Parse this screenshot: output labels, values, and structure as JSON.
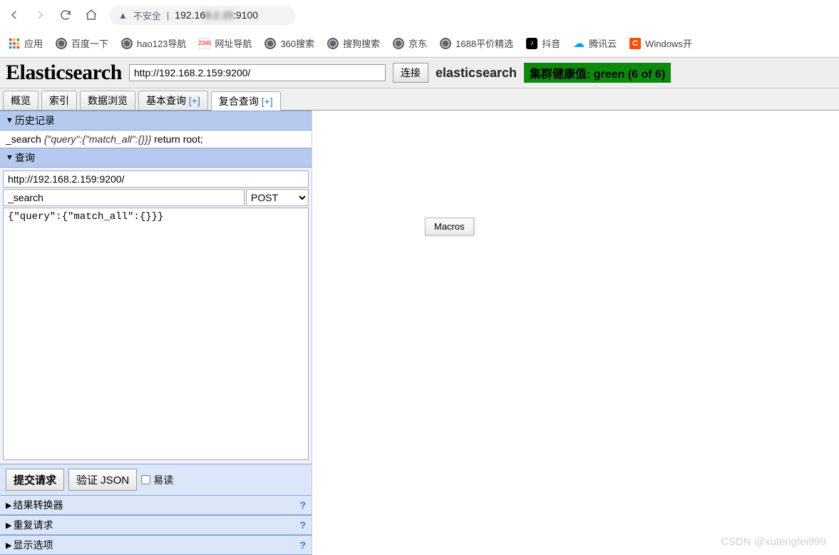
{
  "browser": {
    "insecure_label": "不安全",
    "url_display_prefix": "192.16",
    "url_display_mid": "8.2.15",
    "url_display_suffix": ":9100"
  },
  "bookmarks": {
    "apps": "应用",
    "items": [
      "百度一下",
      "hao123导航",
      "网址导航",
      "360搜索",
      "搜狗搜索",
      "京东",
      "1688平价精选",
      "抖音",
      "腾讯云",
      "Windows开"
    ]
  },
  "es": {
    "logo": "Elasticsearch",
    "server_url": "http://192.168.2.159:9200/",
    "connect_btn": "连接",
    "cluster_name": "elasticsearch",
    "health_text": "集群健康值: green (6 of 6)"
  },
  "tabs": {
    "items": [
      "概览",
      "索引",
      "数据浏览",
      "基本查询",
      "复合查询"
    ],
    "plus": "[+]",
    "active_index": 4
  },
  "sections": {
    "history": {
      "title": "历史记录",
      "entry_path": "_search",
      "entry_body": "{\"query\":{\"match_all\":{}}}",
      "entry_suffix": " return root;"
    },
    "query": {
      "title": "查询",
      "url": "http://192.168.2.159:9200/",
      "path": "_search",
      "method": "POST",
      "body": "{\"query\":{\"match_all\":{}}}",
      "submit": "提交请求",
      "validate": "验证 JSON",
      "pretty": "易读"
    },
    "transformer": "结果转换器",
    "repeat": "重复请求",
    "display": "显示选项",
    "help": "?"
  },
  "macros_btn": "Macros",
  "watermark": "CSDN @xutengfei999"
}
